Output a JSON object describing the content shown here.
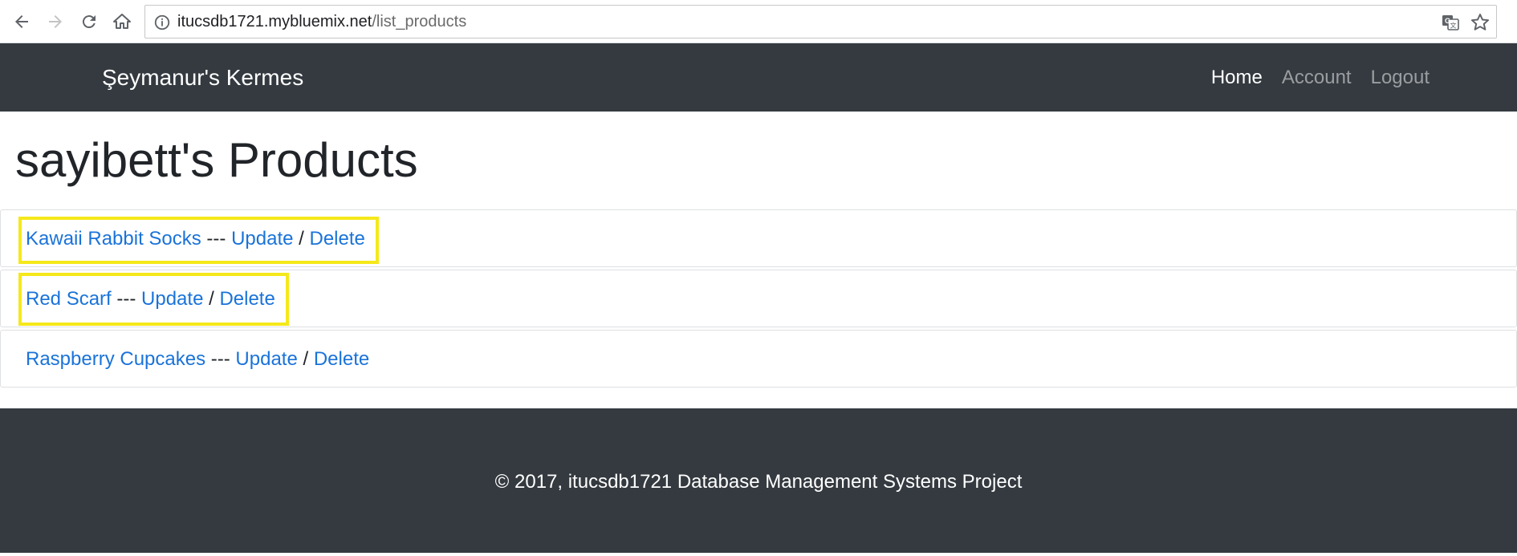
{
  "browser": {
    "url_host": "itucsdb1721.mybluemix.net",
    "url_path": "/list_products"
  },
  "navbar": {
    "brand": "Şeymanur's Kermes",
    "links": [
      {
        "label": "Home",
        "active": true
      },
      {
        "label": "Account",
        "active": false
      },
      {
        "label": "Logout",
        "active": false
      }
    ]
  },
  "main": {
    "title": "sayibett's Products",
    "products": [
      {
        "name": "Kawaii Rabbit Socks",
        "separator": " --- ",
        "update_label": "Update",
        "slash": " / ",
        "delete_label": "Delete",
        "highlighted": true
      },
      {
        "name": "Red Scarf",
        "separator": " --- ",
        "update_label": "Update",
        "slash": " / ",
        "delete_label": "Delete",
        "highlighted": true
      },
      {
        "name": "Raspberry Cupcakes",
        "separator": " --- ",
        "update_label": "Update",
        "slash": " / ",
        "delete_label": "Delete",
        "highlighted": false
      }
    ]
  },
  "footer": {
    "copyright": "© 2017, itucsdb1721 Database Management Systems Project"
  },
  "colors": {
    "navbar_bg": "#343a40",
    "link": "#1a73d9",
    "highlight": "#f5e81a"
  }
}
